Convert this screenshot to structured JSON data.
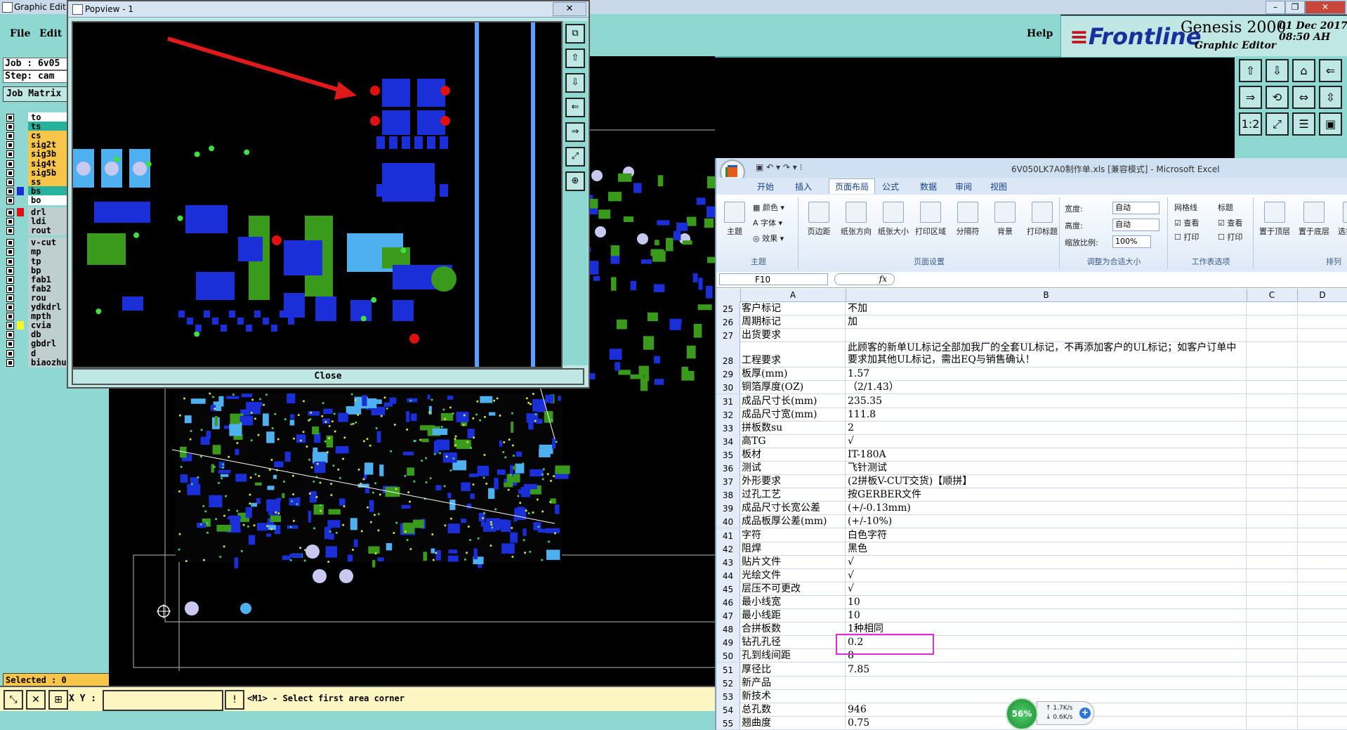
{
  "genesis": {
    "window_title": "Graphic Edit",
    "menu": {
      "file": "File",
      "edit": "Edit",
      "help": "Help"
    },
    "logo": {
      "brand_prefix": "≡",
      "brand": "Frontline",
      "product": "Genesis 2000",
      "subtitle": "Graphic Editor",
      "date": "01 Dec 2017",
      "time": "08:50 AH"
    },
    "job_label": "Job : 6v05",
    "step_label": "Step: cam",
    "job_matrix_label": "Job Matrix",
    "layers": [
      {
        "name": "to",
        "color": "#ffffff"
      },
      {
        "name": "ts",
        "color": "#27b39b"
      },
      {
        "name": "cs",
        "color": "#f7c548"
      },
      {
        "name": "sig2t",
        "color": "#f7c548"
      },
      {
        "name": "sig3b",
        "color": "#f7c548"
      },
      {
        "name": "sig4t",
        "color": "#f7c548"
      },
      {
        "name": "sig5b",
        "color": "#f7c548"
      },
      {
        "name": "ss",
        "color": "#f7c548"
      },
      {
        "name": "bs",
        "color": "#27b39b",
        "active_color": "#1a2fd8"
      },
      {
        "name": "bo",
        "color": "#ffffff"
      },
      {
        "name": "drl",
        "color": "#bfcfcf",
        "active_color": "#e01010"
      },
      {
        "name": "ldi",
        "color": "#bfcfcf"
      },
      {
        "name": "rout",
        "color": "#bfcfcf"
      },
      {
        "name": "v-cut",
        "color": "#bfcfcf"
      },
      {
        "name": "mp",
        "color": "#bfcfcf"
      },
      {
        "name": "tp",
        "color": "#bfcfcf"
      },
      {
        "name": "bp",
        "color": "#bfcfcf"
      },
      {
        "name": "fab1",
        "color": "#bfcfcf"
      },
      {
        "name": "fab2",
        "color": "#bfcfcf"
      },
      {
        "name": "rou",
        "color": "#bfcfcf"
      },
      {
        "name": "ydkdrl",
        "color": "#bfcfcf"
      },
      {
        "name": "mpth",
        "color": "#bfcfcf"
      },
      {
        "name": "cvia",
        "color": "#bfcfcf",
        "active_color": "#f7f72a"
      },
      {
        "name": "db",
        "color": "#bfcfcf"
      },
      {
        "name": "gbdrl",
        "color": "#bfcfcf"
      },
      {
        "name": "d",
        "color": "#bfcfcf"
      },
      {
        "name": "biaozhu",
        "color": "#bfcfcf"
      }
    ],
    "selected_label": "Selected : 0",
    "xy_label": "X Y :",
    "xy_value": "",
    "status_message": "<M1> - Select first area corner"
  },
  "popview": {
    "title": "Popview - 1",
    "close_label": "Close",
    "close_x": "✕"
  },
  "excel": {
    "title": "6V050LK7A0制作单.xls  [兼容模式]  -  Microsoft Excel",
    "tabs": [
      "开始",
      "插入",
      "页面布局",
      "公式",
      "数据",
      "审阅",
      "视图"
    ],
    "active_tab": "页面布局",
    "ribbon": {
      "theme_group": "主题",
      "theme_buttons": [
        "主题"
      ],
      "theme_small": [
        "颜色 ▾",
        "字体 ▾",
        "效果 ▾"
      ],
      "page_setup_group": "页面设置",
      "page_setup_buttons": [
        "页边距",
        "纸张方向",
        "纸张大小",
        "打印区域",
        "分隔符",
        "背景",
        "打印标题"
      ],
      "fit_group": "调整为合适大小",
      "fit_labels": [
        "宽度:",
        "高度:",
        "缩放比例:"
      ],
      "fit_values": [
        "自动",
        "自动",
        "100%"
      ],
      "sheet_group": "工作表选项",
      "gridlines": "网格线",
      "headings": "标题",
      "view": "查看",
      "print": "打印",
      "arrange_buttons": [
        "置于顶层",
        "置于底层",
        "选择窗格"
      ],
      "arrange_group": "排列"
    },
    "name_box": "F10",
    "fx": "fx",
    "columns": [
      "A",
      "B",
      "C",
      "D"
    ],
    "rows": [
      {
        "n": "25",
        "a": "客户标记",
        "b": "不加"
      },
      {
        "n": "26",
        "a": "周期标记",
        "b": "加"
      },
      {
        "n": "27",
        "a": "出货要求",
        "b": ""
      },
      {
        "n": "28",
        "a": "工程要求",
        "b": "此顾客的新单UL标记全部加我厂的全套UL标记，不再添加客户的UL标记；如客户订单中要求加其他UL标记，需出EQ与销售确认！",
        "tall": true
      },
      {
        "n": "29",
        "a": "板厚(mm)",
        "b": "1.57"
      },
      {
        "n": "30",
        "a": "铜箔厚度(OZ)",
        "b": "（2/1.43）"
      },
      {
        "n": "31",
        "a": "成品尺寸长(mm)",
        "b": "235.35"
      },
      {
        "n": "32",
        "a": "成品尺寸宽(mm)",
        "b": "111.8"
      },
      {
        "n": "33",
        "a": "拼板数su",
        "b": "2"
      },
      {
        "n": "34",
        "a": "高TG",
        "b": "√"
      },
      {
        "n": "35",
        "a": "板材",
        "b": "IT-180A"
      },
      {
        "n": "36",
        "a": "测试",
        "b": "飞针测试"
      },
      {
        "n": "37",
        "a": "外形要求",
        "b": "(2拼板V-CUT交货)【顺拼】"
      },
      {
        "n": "38",
        "a": "过孔工艺",
        "b": "按GERBER文件"
      },
      {
        "n": "39",
        "a": "成品尺寸长宽公差",
        "b": "(+/-0.13mm)"
      },
      {
        "n": "40",
        "a": "成品板厚公差(mm)",
        "b": "(+/-10%)"
      },
      {
        "n": "41",
        "a": "字符",
        "b": "白色字符"
      },
      {
        "n": "42",
        "a": "阻焊",
        "b": "黑色"
      },
      {
        "n": "43",
        "a": "贴片文件",
        "b": "√"
      },
      {
        "n": "44",
        "a": "光绘文件",
        "b": "√"
      },
      {
        "n": "45",
        "a": "层压不可更改",
        "b": "√"
      },
      {
        "n": "46",
        "a": "最小线宽",
        "b": "10"
      },
      {
        "n": "47",
        "a": "最小线距",
        "b": "10"
      },
      {
        "n": "48",
        "a": "合拼板数",
        "b": "1种相同"
      },
      {
        "n": "49",
        "a": "钻孔孔径",
        "b": "0.2"
      },
      {
        "n": "50",
        "a": "孔到线间距",
        "b": "8"
      },
      {
        "n": "51",
        "a": "厚径比",
        "b": "7.85"
      },
      {
        "n": "52",
        "a": "新产品",
        "b": ""
      },
      {
        "n": "53",
        "a": "新技术",
        "b": ""
      },
      {
        "n": "54",
        "a": "总孔数",
        "b": "946"
      },
      {
        "n": "55",
        "a": "翘曲度",
        "b": "0.75"
      }
    ]
  },
  "net_widget": {
    "percent": "56%",
    "up": "↑  1.7K/s",
    "down": "↓  0.6K/s",
    "plus": "+"
  }
}
